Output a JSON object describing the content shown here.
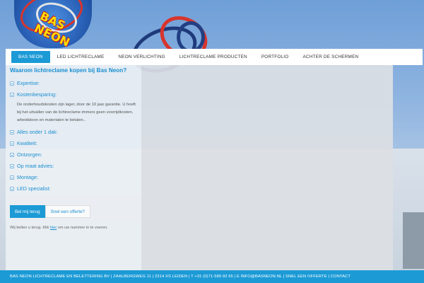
{
  "brand": {
    "logo_text": "BAS NEON"
  },
  "nav": {
    "items": [
      {
        "label": "BAS NEON",
        "active": true
      },
      {
        "label": "LED LICHTRECLAME",
        "active": false
      },
      {
        "label": "NEON VERLICHTING",
        "active": false
      },
      {
        "label": "LICHTRECLAME PRODUCTEN",
        "active": false
      },
      {
        "label": "PORTFOLIO",
        "active": false
      },
      {
        "label": "ACHTER DE SCHERMEN",
        "active": false
      }
    ]
  },
  "content": {
    "headline": "Waarom lichtreclame kopen bij Bas Neon?",
    "accordion": [
      {
        "label": "Expertise:"
      },
      {
        "label": "Kostenbesparing:"
      },
      {
        "label": "Alles onder 1 dak:"
      },
      {
        "label": "Kwaliteit:"
      },
      {
        "label": "Ontzorgen:"
      },
      {
        "label": "Op maat advies:"
      },
      {
        "label": "Montage:"
      },
      {
        "label": "LED specialist:"
      }
    ],
    "expanded_text": "De onderhoudskosten zijn lager, door de 10 jaar garantie. U hoeft bij het uitvallen van de lichtreclame immers geen voorrijdkosten, arbeidsloon en materialen te betalen..",
    "call_button": "Bel mij terug",
    "quote_button": "Snel een offerte?",
    "call_note_before": "Wij bellen u terug. Klik ",
    "call_note_link": "hier",
    "call_note_after": " om uw nummer in te voeren."
  },
  "footer": {
    "text": "BAS NEON LICHTRECLAME EN BELETTERING BV | ZAALBERGWEG 11 | 2314 XS LEIDEN | T +31 (0)71-589 92 65 | E INFO@BASNEON.NL | SNEL EEN OFFERTE | CONTACT"
  },
  "colors": {
    "accent": "#1b9ad6",
    "headline": "#1b8fd0",
    "footer_bg": "#1b9ad6"
  }
}
